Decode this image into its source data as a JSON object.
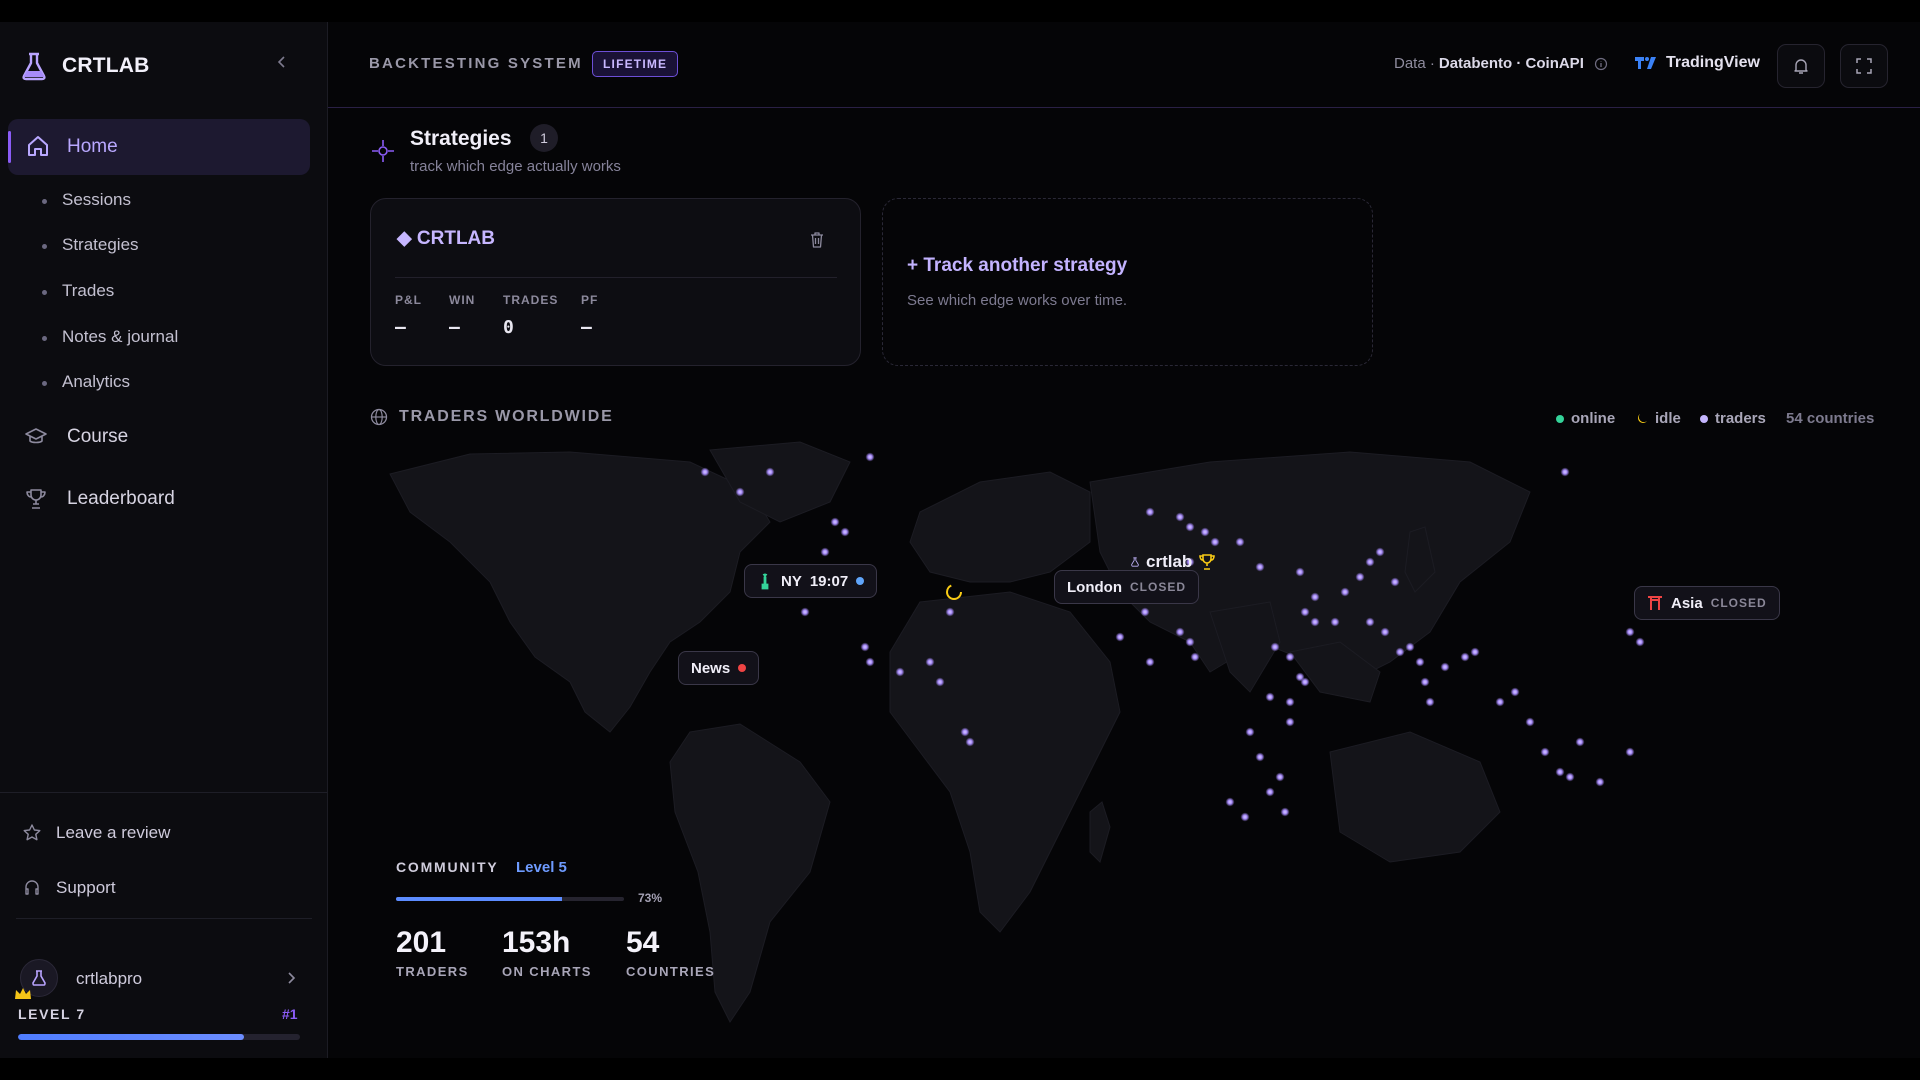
{
  "brand": {
    "name": "CRTLAB"
  },
  "sidebar": {
    "home_label": "Home",
    "sub_items": [
      {
        "label": "Sessions"
      },
      {
        "label": "Strategies"
      },
      {
        "label": "Trades"
      },
      {
        "label": "Notes & journal"
      },
      {
        "label": "Analytics"
      }
    ],
    "course_label": "Course",
    "leaderboard_label": "Leaderboard",
    "review_label": "Leave a review",
    "support_label": "Support",
    "user": {
      "name": "crtlabpro",
      "level": "LEVEL 7",
      "rank": "#1",
      "level_progress": 0.8
    }
  },
  "header": {
    "title": "BACKTESTING SYSTEM",
    "badge": "LIFETIME",
    "data_prefix": "Data ·",
    "data_providers": "Databento · CoinAPI",
    "tradingview_label": "TradingView"
  },
  "strategies": {
    "title": "Strategies",
    "count": "1",
    "subtitle": "track which edge actually works",
    "card": {
      "title": "◆ CRTLAB",
      "stats": [
        {
          "key": "P&L",
          "value": "—"
        },
        {
          "key": "WIN",
          "value": "—"
        },
        {
          "key": "TRADES",
          "value": "0"
        },
        {
          "key": "PF",
          "value": "—"
        }
      ]
    },
    "add_card": {
      "title": "+ Track another strategy",
      "description": "See which edge works over time."
    }
  },
  "worldwide": {
    "title": "TRADERS WORLDWIDE",
    "legend": [
      {
        "label": "online",
        "color": "#34d399"
      },
      {
        "label": "idle",
        "color": "#facc15"
      },
      {
        "label": "traders",
        "color": "#c4b5fd"
      }
    ],
    "countries_label": "54 countries",
    "markers": {
      "ny": {
        "label": "NY",
        "time": "19:07"
      },
      "news": {
        "label": "News"
      },
      "london": {
        "label": "London",
        "status": "CLOSED"
      },
      "asia": {
        "label": "Asia",
        "status": "CLOSED"
      },
      "user_label": "crtlab"
    }
  },
  "community": {
    "label": "COMMUNITY",
    "level": "Level 5",
    "progress_pct": "73%",
    "progress": 0.73,
    "stats": [
      {
        "value": "201",
        "label": "TRADERS"
      },
      {
        "value": "153h",
        "label": "ON CHARTS"
      },
      {
        "value": "54",
        "label": "COUNTRIES"
      }
    ]
  },
  "colors": {
    "accent": "#8b5cf6",
    "bg": "#050507",
    "sidebar_bg": "#0c0c10"
  }
}
